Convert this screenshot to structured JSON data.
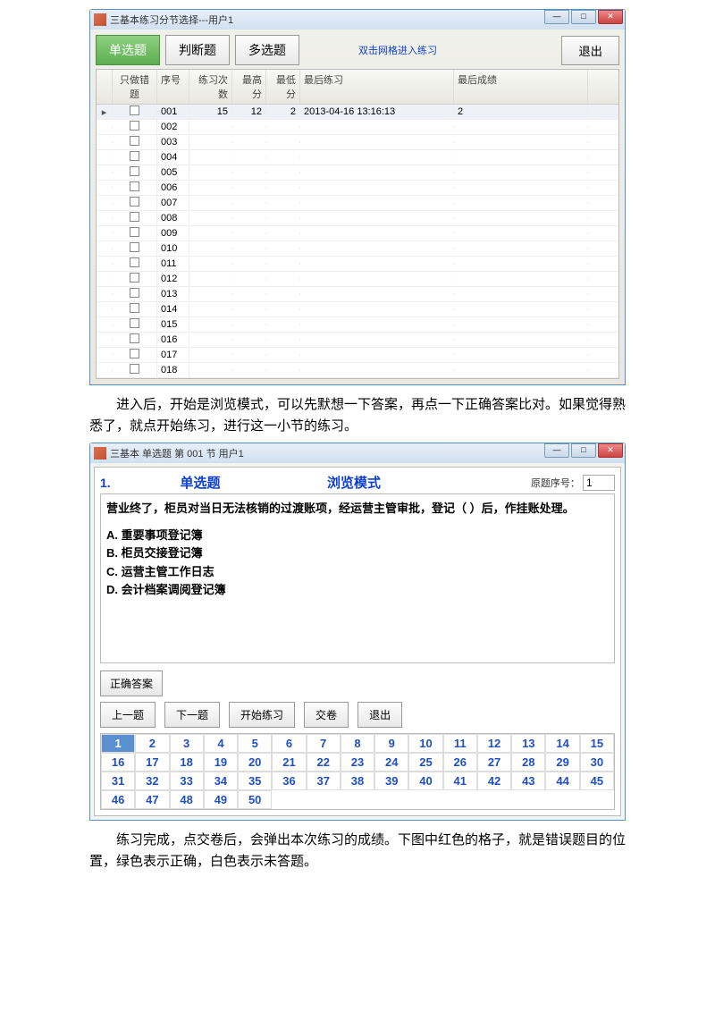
{
  "window1": {
    "title": "三基本练习分节选择---用户1",
    "tabs": {
      "single": "单选题",
      "judge": "判断题",
      "multi": "多选题"
    },
    "hint_link": "双击网格进入练习",
    "exit": "退出",
    "columns": {
      "chk": "只做错题",
      "seq": "序号",
      "cnt": "练习次数",
      "hi": "最高分",
      "lo": "最低分",
      "last": "最后练习",
      "score": "最后成绩"
    },
    "rows": [
      {
        "seq": "001",
        "cnt": "15",
        "hi": "12",
        "lo": "2",
        "last": "2013-04-16 13:16:13",
        "score": "2",
        "selected": true
      },
      {
        "seq": "002"
      },
      {
        "seq": "003"
      },
      {
        "seq": "004"
      },
      {
        "seq": "005"
      },
      {
        "seq": "006"
      },
      {
        "seq": "007"
      },
      {
        "seq": "008"
      },
      {
        "seq": "009"
      },
      {
        "seq": "010"
      },
      {
        "seq": "011"
      },
      {
        "seq": "012"
      },
      {
        "seq": "013"
      },
      {
        "seq": "014"
      },
      {
        "seq": "015"
      },
      {
        "seq": "016"
      },
      {
        "seq": "017"
      },
      {
        "seq": "018"
      }
    ]
  },
  "paragraph1": "进入后，开始是浏览模式，可以先默想一下答案，再点一下正确答案比对。如果觉得熟悉了，就点开始练习，进行这一小节的练习。",
  "window2": {
    "title": "三基本 单选题 第 001 节 用户1",
    "num": "1.",
    "type_label": "单选题",
    "mode_label": "浏览模式",
    "orig_label": "原题序号：",
    "orig_value": "1",
    "question": "营业终了，柜员对当日无法核销的过渡账项，经运营主管审批，登记（ ）后，作挂账处理。",
    "options": {
      "a": "A. 重要事项登记簿",
      "b": "B. 柜员交接登记簿",
      "c": "C. 运营主管工作日志",
      "d": "D. 会计档案调阅登记簿"
    },
    "buttons": {
      "answer": "正确答案",
      "prev": "上一题",
      "next": "下一题",
      "start": "开始练习",
      "submit": "交卷",
      "exit": "退出"
    },
    "grid_total": 50,
    "grid_current": 1
  },
  "paragraph2": "练习完成，点交卷后，会弹出本次练习的成绩。下图中红色的格子，就是错误题目的位置，绿色表示正确，白色表示未答题。"
}
